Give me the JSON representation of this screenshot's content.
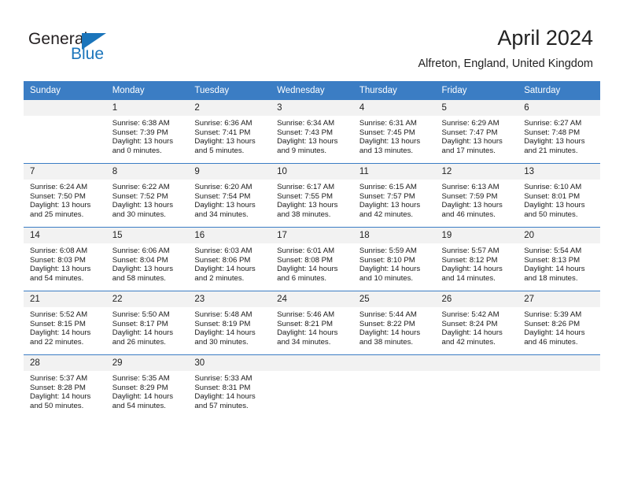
{
  "logo": {
    "word_top": "General",
    "word_bottom": "Blue",
    "accent_color": "#1b75bb"
  },
  "header": {
    "title": "April 2024",
    "subtitle": "Alfreton, England, United Kingdom"
  },
  "calendar": {
    "header_bg": "#3b7dc4",
    "daynum_bg": "#f2f2f2",
    "weekday_labels": [
      "Sunday",
      "Monday",
      "Tuesday",
      "Wednesday",
      "Thursday",
      "Friday",
      "Saturday"
    ],
    "weeks": [
      [
        {
          "day": "",
          "blank": true
        },
        {
          "day": "1",
          "sunrise": "Sunrise: 6:38 AM",
          "sunset": "Sunset: 7:39 PM",
          "daylight1": "Daylight: 13 hours",
          "daylight2": "and 0 minutes."
        },
        {
          "day": "2",
          "sunrise": "Sunrise: 6:36 AM",
          "sunset": "Sunset: 7:41 PM",
          "daylight1": "Daylight: 13 hours",
          "daylight2": "and 5 minutes."
        },
        {
          "day": "3",
          "sunrise": "Sunrise: 6:34 AM",
          "sunset": "Sunset: 7:43 PM",
          "daylight1": "Daylight: 13 hours",
          "daylight2": "and 9 minutes."
        },
        {
          "day": "4",
          "sunrise": "Sunrise: 6:31 AM",
          "sunset": "Sunset: 7:45 PM",
          "daylight1": "Daylight: 13 hours",
          "daylight2": "and 13 minutes."
        },
        {
          "day": "5",
          "sunrise": "Sunrise: 6:29 AM",
          "sunset": "Sunset: 7:47 PM",
          "daylight1": "Daylight: 13 hours",
          "daylight2": "and 17 minutes."
        },
        {
          "day": "6",
          "sunrise": "Sunrise: 6:27 AM",
          "sunset": "Sunset: 7:48 PM",
          "daylight1": "Daylight: 13 hours",
          "daylight2": "and 21 minutes."
        }
      ],
      [
        {
          "day": "7",
          "sunrise": "Sunrise: 6:24 AM",
          "sunset": "Sunset: 7:50 PM",
          "daylight1": "Daylight: 13 hours",
          "daylight2": "and 25 minutes."
        },
        {
          "day": "8",
          "sunrise": "Sunrise: 6:22 AM",
          "sunset": "Sunset: 7:52 PM",
          "daylight1": "Daylight: 13 hours",
          "daylight2": "and 30 minutes."
        },
        {
          "day": "9",
          "sunrise": "Sunrise: 6:20 AM",
          "sunset": "Sunset: 7:54 PM",
          "daylight1": "Daylight: 13 hours",
          "daylight2": "and 34 minutes."
        },
        {
          "day": "10",
          "sunrise": "Sunrise: 6:17 AM",
          "sunset": "Sunset: 7:55 PM",
          "daylight1": "Daylight: 13 hours",
          "daylight2": "and 38 minutes."
        },
        {
          "day": "11",
          "sunrise": "Sunrise: 6:15 AM",
          "sunset": "Sunset: 7:57 PM",
          "daylight1": "Daylight: 13 hours",
          "daylight2": "and 42 minutes."
        },
        {
          "day": "12",
          "sunrise": "Sunrise: 6:13 AM",
          "sunset": "Sunset: 7:59 PM",
          "daylight1": "Daylight: 13 hours",
          "daylight2": "and 46 minutes."
        },
        {
          "day": "13",
          "sunrise": "Sunrise: 6:10 AM",
          "sunset": "Sunset: 8:01 PM",
          "daylight1": "Daylight: 13 hours",
          "daylight2": "and 50 minutes."
        }
      ],
      [
        {
          "day": "14",
          "sunrise": "Sunrise: 6:08 AM",
          "sunset": "Sunset: 8:03 PM",
          "daylight1": "Daylight: 13 hours",
          "daylight2": "and 54 minutes."
        },
        {
          "day": "15",
          "sunrise": "Sunrise: 6:06 AM",
          "sunset": "Sunset: 8:04 PM",
          "daylight1": "Daylight: 13 hours",
          "daylight2": "and 58 minutes."
        },
        {
          "day": "16",
          "sunrise": "Sunrise: 6:03 AM",
          "sunset": "Sunset: 8:06 PM",
          "daylight1": "Daylight: 14 hours",
          "daylight2": "and 2 minutes."
        },
        {
          "day": "17",
          "sunrise": "Sunrise: 6:01 AM",
          "sunset": "Sunset: 8:08 PM",
          "daylight1": "Daylight: 14 hours",
          "daylight2": "and 6 minutes."
        },
        {
          "day": "18",
          "sunrise": "Sunrise: 5:59 AM",
          "sunset": "Sunset: 8:10 PM",
          "daylight1": "Daylight: 14 hours",
          "daylight2": "and 10 minutes."
        },
        {
          "day": "19",
          "sunrise": "Sunrise: 5:57 AM",
          "sunset": "Sunset: 8:12 PM",
          "daylight1": "Daylight: 14 hours",
          "daylight2": "and 14 minutes."
        },
        {
          "day": "20",
          "sunrise": "Sunrise: 5:54 AM",
          "sunset": "Sunset: 8:13 PM",
          "daylight1": "Daylight: 14 hours",
          "daylight2": "and 18 minutes."
        }
      ],
      [
        {
          "day": "21",
          "sunrise": "Sunrise: 5:52 AM",
          "sunset": "Sunset: 8:15 PM",
          "daylight1": "Daylight: 14 hours",
          "daylight2": "and 22 minutes."
        },
        {
          "day": "22",
          "sunrise": "Sunrise: 5:50 AM",
          "sunset": "Sunset: 8:17 PM",
          "daylight1": "Daylight: 14 hours",
          "daylight2": "and 26 minutes."
        },
        {
          "day": "23",
          "sunrise": "Sunrise: 5:48 AM",
          "sunset": "Sunset: 8:19 PM",
          "daylight1": "Daylight: 14 hours",
          "daylight2": "and 30 minutes."
        },
        {
          "day": "24",
          "sunrise": "Sunrise: 5:46 AM",
          "sunset": "Sunset: 8:21 PM",
          "daylight1": "Daylight: 14 hours",
          "daylight2": "and 34 minutes."
        },
        {
          "day": "25",
          "sunrise": "Sunrise: 5:44 AM",
          "sunset": "Sunset: 8:22 PM",
          "daylight1": "Daylight: 14 hours",
          "daylight2": "and 38 minutes."
        },
        {
          "day": "26",
          "sunrise": "Sunrise: 5:42 AM",
          "sunset": "Sunset: 8:24 PM",
          "daylight1": "Daylight: 14 hours",
          "daylight2": "and 42 minutes."
        },
        {
          "day": "27",
          "sunrise": "Sunrise: 5:39 AM",
          "sunset": "Sunset: 8:26 PM",
          "daylight1": "Daylight: 14 hours",
          "daylight2": "and 46 minutes."
        }
      ],
      [
        {
          "day": "28",
          "sunrise": "Sunrise: 5:37 AM",
          "sunset": "Sunset: 8:28 PM",
          "daylight1": "Daylight: 14 hours",
          "daylight2": "and 50 minutes."
        },
        {
          "day": "29",
          "sunrise": "Sunrise: 5:35 AM",
          "sunset": "Sunset: 8:29 PM",
          "daylight1": "Daylight: 14 hours",
          "daylight2": "and 54 minutes."
        },
        {
          "day": "30",
          "sunrise": "Sunrise: 5:33 AM",
          "sunset": "Sunset: 8:31 PM",
          "daylight1": "Daylight: 14 hours",
          "daylight2": "and 57 minutes."
        },
        {
          "day": "",
          "blank": true
        },
        {
          "day": "",
          "blank": true
        },
        {
          "day": "",
          "blank": true
        },
        {
          "day": "",
          "blank": true
        }
      ]
    ]
  }
}
